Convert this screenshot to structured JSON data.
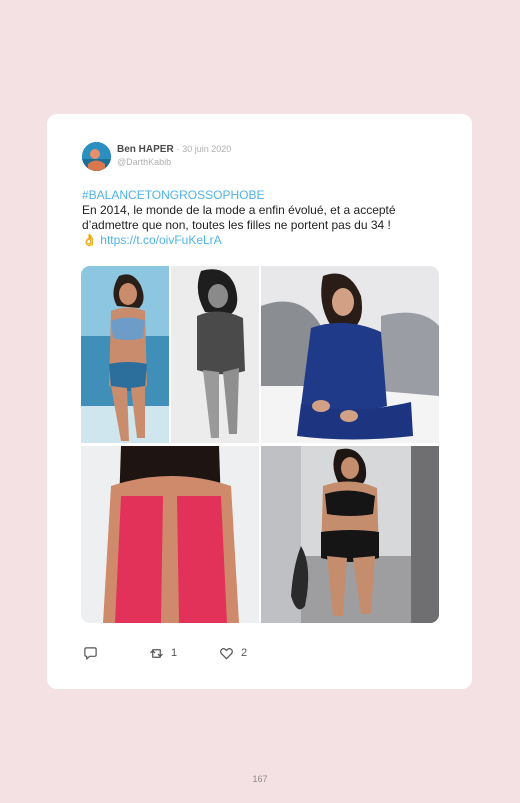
{
  "tweet": {
    "author_name": "Ben HAPER",
    "separator": "·",
    "date": "30 juin 2020",
    "handle": "@DarthKabib",
    "hashtag": "#BALANCETONGROSSOPHOBE",
    "body_text": "En 2014, le monde de la mode a enfin évolué, et a accepté d’admettre que non, toutes les filles ne portent pas du 34 !",
    "emoji": "👌",
    "link": "https://t.co/oivFuKeLrA",
    "retweet_count": "1",
    "like_count": "2"
  },
  "icons": {
    "reply": "reply-icon",
    "retweet": "retweet-icon",
    "like": "heart-icon"
  },
  "colors": {
    "page_background": "#f4e1e3",
    "card_background": "#ffffff",
    "link_color": "#4fb3e6"
  },
  "page_number": "167"
}
